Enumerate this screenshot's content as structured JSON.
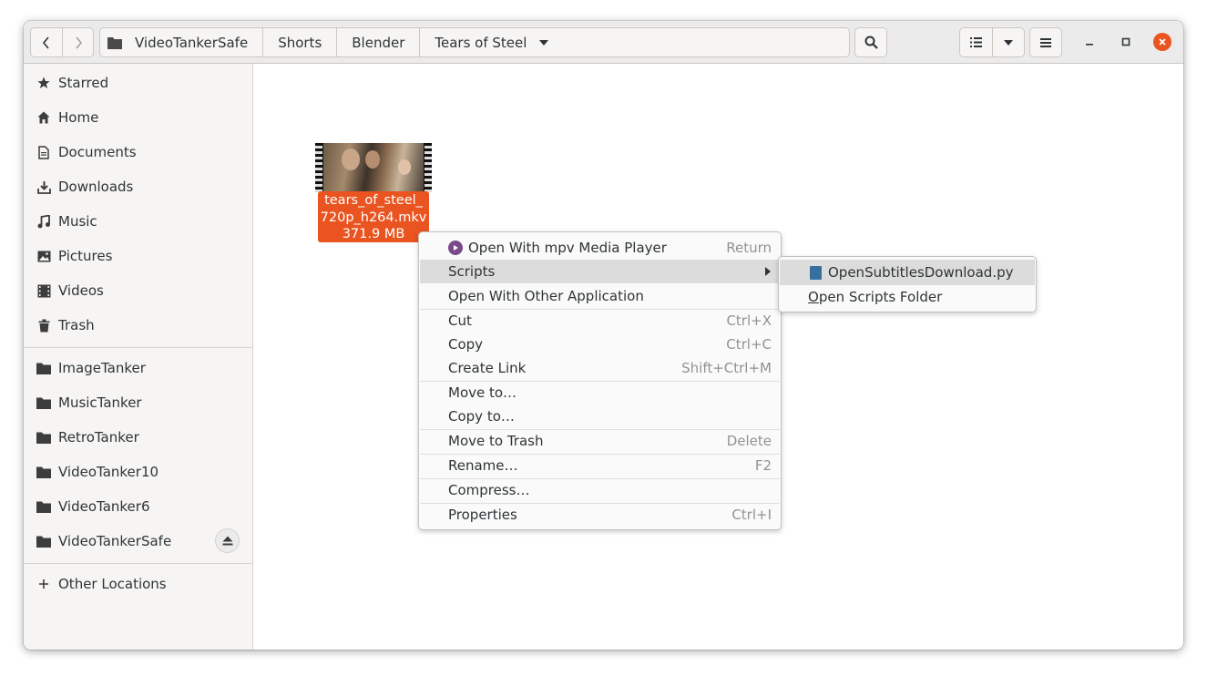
{
  "window": {
    "path": [
      {
        "label": "VideoTankerSafe"
      },
      {
        "label": "Shorts"
      },
      {
        "label": "Blender"
      },
      {
        "label": "Tears of Steel"
      }
    ]
  },
  "sidebar": {
    "places": [
      {
        "label": "Starred",
        "icon": "star-icon"
      },
      {
        "label": "Home",
        "icon": "home-icon"
      },
      {
        "label": "Documents",
        "icon": "document-icon"
      },
      {
        "label": "Downloads",
        "icon": "download-icon"
      },
      {
        "label": "Music",
        "icon": "music-icon"
      },
      {
        "label": "Pictures",
        "icon": "picture-icon"
      },
      {
        "label": "Videos",
        "icon": "video-icon"
      },
      {
        "label": "Trash",
        "icon": "trash-icon"
      }
    ],
    "drives": [
      {
        "label": "ImageTanker"
      },
      {
        "label": "MusicTanker"
      },
      {
        "label": "RetroTanker"
      },
      {
        "label": "VideoTanker10"
      },
      {
        "label": "VideoTanker6"
      },
      {
        "label": "VideoTankerSafe"
      }
    ],
    "other_locations": "Other Locations"
  },
  "file": {
    "name_line1": "tears_of_steel_",
    "name_line2": "720p_h264.mkv",
    "size": "371.9 MB"
  },
  "context_menu": {
    "open_with_mpv": "Open With mpv Media Player",
    "open_with_mpv_accel": "Return",
    "scripts": "Scripts",
    "open_with_other": "Open With Other Application",
    "cut": "Cut",
    "cut_accel": "Ctrl+X",
    "copy": "Copy",
    "copy_accel": "Ctrl+C",
    "create_link": "Create Link",
    "create_link_accel": "Shift+Ctrl+M",
    "move_to": "Move to…",
    "copy_to": "Copy to…",
    "move_to_trash": "Move to Trash",
    "move_to_trash_accel": "Delete",
    "rename": "Rename…",
    "rename_accel": "F2",
    "compress": "Compress…",
    "properties": "Properties",
    "properties_accel": "Ctrl+I"
  },
  "scripts_submenu": {
    "script_item": "OpenSubtitlesDownload.py",
    "open_folder_first": "O",
    "open_folder_rest": "pen Scripts Folder"
  },
  "colors": {
    "accent": "#e95420",
    "highlight": "#dcdcdc",
    "sidebar_bg": "#f6f5f4"
  }
}
